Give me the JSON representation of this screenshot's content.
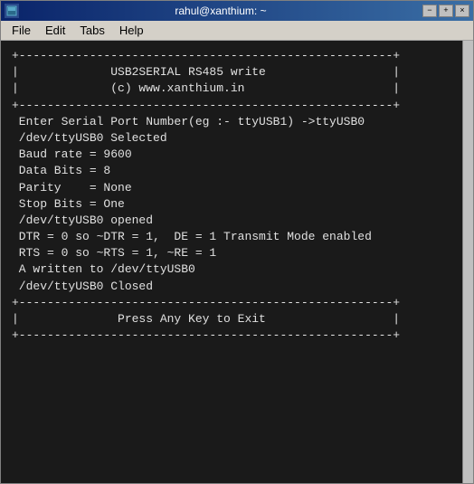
{
  "window": {
    "title": "rahul@xanthium: ~",
    "icon": "terminal"
  },
  "titlebar": {
    "minimize_label": "−",
    "maximize_label": "+",
    "close_label": "×"
  },
  "menubar": {
    "items": [
      "File",
      "Edit",
      "Tabs",
      "Help"
    ]
  },
  "terminal": {
    "lines": [
      "+-----------------------------------------------------+",
      "|             USB2SERIAL RS485 write                  |",
      "|             (c) www.xanthium.in                     |",
      "+-----------------------------------------------------+",
      " Enter Serial Port Number(eg :- ttyUSB1) ->ttyUSB0",
      "",
      " /dev/ttyUSB0 Selected",
      "",
      " Baud rate = 9600",
      " Data Bits = 8",
      " Parity    = None",
      " Stop Bits = One",
      "",
      " /dev/ttyUSB0 opened",
      "",
      " DTR = 0 so ~DTR = 1,  DE = 1 Transmit Mode enabled",
      " RTS = 0 so ~RTS = 1, ~RE = 1",
      "",
      " A written to /dev/ttyUSB0",
      "",
      " /dev/ttyUSB0 Closed",
      "",
      "+-----------------------------------------------------+",
      "|              Press Any Key to Exit                  |",
      "+-----------------------------------------------------+"
    ]
  }
}
